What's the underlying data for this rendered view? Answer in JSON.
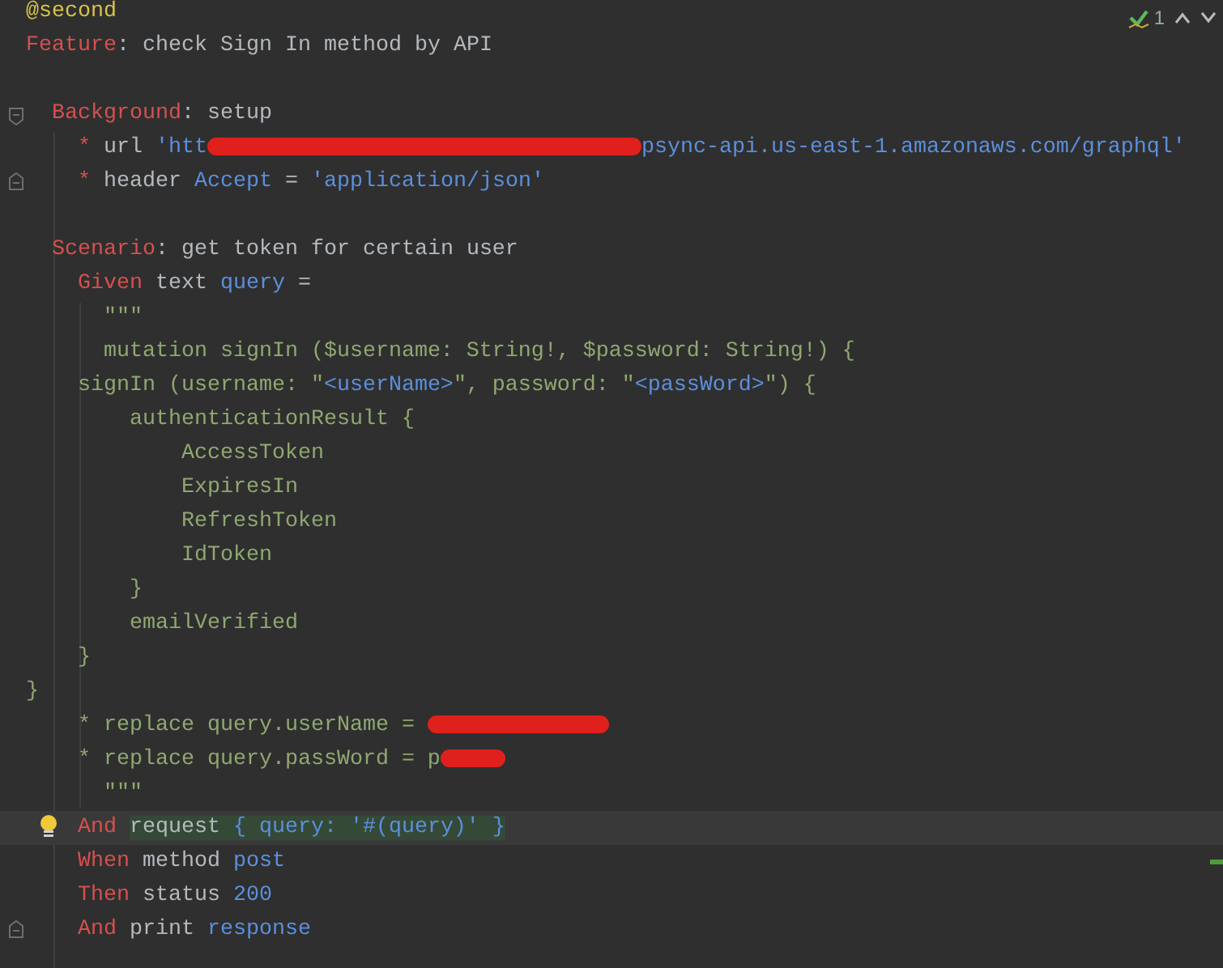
{
  "inspection": {
    "count": "1"
  },
  "lines": [
    {
      "kind": "code",
      "tokens": [
        {
          "kind": "tag",
          "text": "@second"
        }
      ]
    },
    {
      "kind": "code",
      "tokens": [
        {
          "kind": "keyword",
          "text": "Feature"
        },
        {
          "kind": "plain",
          "text": ": check Sign In method by API"
        }
      ]
    },
    {
      "kind": "blank"
    },
    {
      "kind": "code",
      "indent": {
        "kind": "w2"
      },
      "gutter": {
        "kind": "foldstart"
      },
      "tokens": [
        {
          "kind": "keyword",
          "text": "Background"
        },
        {
          "kind": "plain",
          "text": ": setup"
        }
      ]
    },
    {
      "kind": "code",
      "indent": {
        "kind": "w4"
      },
      "tokens": [
        {
          "kind": "keyword",
          "text": "*"
        },
        {
          "kind": "plain",
          "text": " url "
        },
        {
          "kind": "string",
          "text": "'htt"
        },
        {
          "kind": "redactionlong"
        },
        {
          "kind": "string",
          "text": "psync-api.us-east-1.amazonaws.com/graphql'"
        }
      ]
    },
    {
      "kind": "code",
      "indent": {
        "kind": "w4"
      },
      "gutter": {
        "kind": "foldend"
      },
      "tokens": [
        {
          "kind": "keyword",
          "text": "*"
        },
        {
          "kind": "plain",
          "text": " header "
        },
        {
          "kind": "string",
          "text": "Accept"
        },
        {
          "kind": "plain",
          "text": " = "
        },
        {
          "kind": "string",
          "text": "'application/json'"
        }
      ]
    },
    {
      "kind": "blank"
    },
    {
      "kind": "code",
      "indent": {
        "kind": "w2"
      },
      "tokens": [
        {
          "kind": "keyword",
          "text": "Scenario"
        },
        {
          "kind": "plain",
          "text": ": get token for certain user"
        }
      ]
    },
    {
      "kind": "code",
      "indent": {
        "kind": "w4"
      },
      "tokens": [
        {
          "kind": "keyword",
          "text": "Given"
        },
        {
          "kind": "plain",
          "text": " text "
        },
        {
          "kind": "string",
          "text": "query"
        },
        {
          "kind": "plain",
          "text": " ="
        }
      ]
    },
    {
      "kind": "code",
      "indent": {
        "kind": "w6"
      },
      "tokens": [
        {
          "kind": "doc",
          "text": "\"\"\""
        }
      ]
    },
    {
      "kind": "code",
      "indent": {
        "kind": "w6"
      },
      "tokens": [
        {
          "kind": "doc",
          "text": "mutation signIn ($username: String!, $password: String!) {"
        }
      ]
    },
    {
      "kind": "code",
      "indent": {
        "kind": "w4"
      },
      "tokens": [
        {
          "kind": "doc",
          "text": "signIn (username: \""
        },
        {
          "kind": "string",
          "text": "<userName>"
        },
        {
          "kind": "doc",
          "text": "\", password: \""
        },
        {
          "kind": "string",
          "text": "<passWord>"
        },
        {
          "kind": "doc",
          "text": "\") {"
        }
      ]
    },
    {
      "kind": "code",
      "indent": {
        "kind": "w8"
      },
      "tokens": [
        {
          "kind": "doc",
          "text": "authenticationResult {"
        }
      ]
    },
    {
      "kind": "code",
      "indent": {
        "kind": "w12"
      },
      "tokens": [
        {
          "kind": "doc",
          "text": "AccessToken"
        }
      ]
    },
    {
      "kind": "code",
      "indent": {
        "kind": "w12"
      },
      "tokens": [
        {
          "kind": "doc",
          "text": "ExpiresIn"
        }
      ]
    },
    {
      "kind": "code",
      "indent": {
        "kind": "w12"
      },
      "tokens": [
        {
          "kind": "doc",
          "text": "RefreshToken"
        }
      ]
    },
    {
      "kind": "code",
      "indent": {
        "kind": "w12"
      },
      "tokens": [
        {
          "kind": "doc",
          "text": "IdToken"
        }
      ]
    },
    {
      "kind": "code",
      "indent": {
        "kind": "w8"
      },
      "tokens": [
        {
          "kind": "doc",
          "text": "}"
        }
      ]
    },
    {
      "kind": "code",
      "indent": {
        "kind": "w8"
      },
      "tokens": [
        {
          "kind": "doc",
          "text": "emailVerified"
        }
      ]
    },
    {
      "kind": "code",
      "indent": {
        "kind": "w4"
      },
      "tokens": [
        {
          "kind": "doc",
          "text": "}"
        }
      ]
    },
    {
      "kind": "code",
      "tokens": [
        {
          "kind": "doc",
          "text": "}"
        }
      ]
    },
    {
      "kind": "code",
      "indent": {
        "kind": "w4"
      },
      "tokens": [
        {
          "kind": "doc",
          "text": "* replace query.userName = "
        },
        {
          "kind": "redactionmedium"
        }
      ]
    },
    {
      "kind": "code",
      "indent": {
        "kind": "w4"
      },
      "tokens": [
        {
          "kind": "doc",
          "text": "* replace query.passWord = p"
        },
        {
          "kind": "redactionshort"
        }
      ]
    },
    {
      "kind": "code",
      "indent": {
        "kind": "w6"
      },
      "tokens": [
        {
          "kind": "doc",
          "text": "\"\"\""
        }
      ]
    },
    {
      "kind": "code",
      "indent": {
        "kind": "w4"
      },
      "current": true,
      "gutter": {
        "kind": "bulb"
      },
      "tokens": [
        {
          "kind": "keyword",
          "text": "And"
        },
        {
          "kind": "plain",
          "text": "request",
          "highlighted": true
        },
        {
          "kind": "string",
          "text": " { query: '#(query)' }",
          "highlighted": true
        }
      ]
    },
    {
      "kind": "code",
      "indent": {
        "kind": "w4"
      },
      "marker": {
        "kind": "change"
      },
      "tokens": [
        {
          "kind": "keyword",
          "text": "When"
        },
        {
          "kind": "plain",
          "text": " method "
        },
        {
          "kind": "string",
          "text": "post"
        }
      ]
    },
    {
      "kind": "code",
      "indent": {
        "kind": "w4"
      },
      "tokens": [
        {
          "kind": "keyword",
          "text": "Then"
        },
        {
          "kind": "plain",
          "text": " status "
        },
        {
          "kind": "string",
          "text": "200"
        }
      ]
    },
    {
      "kind": "code",
      "indent": {
        "kind": "w4"
      },
      "gutter": {
        "kind": "foldend"
      },
      "tokens": [
        {
          "kind": "keyword",
          "text": "And"
        },
        {
          "kind": "plain",
          "text": " print "
        },
        {
          "kind": "string",
          "text": "response"
        }
      ]
    }
  ]
}
